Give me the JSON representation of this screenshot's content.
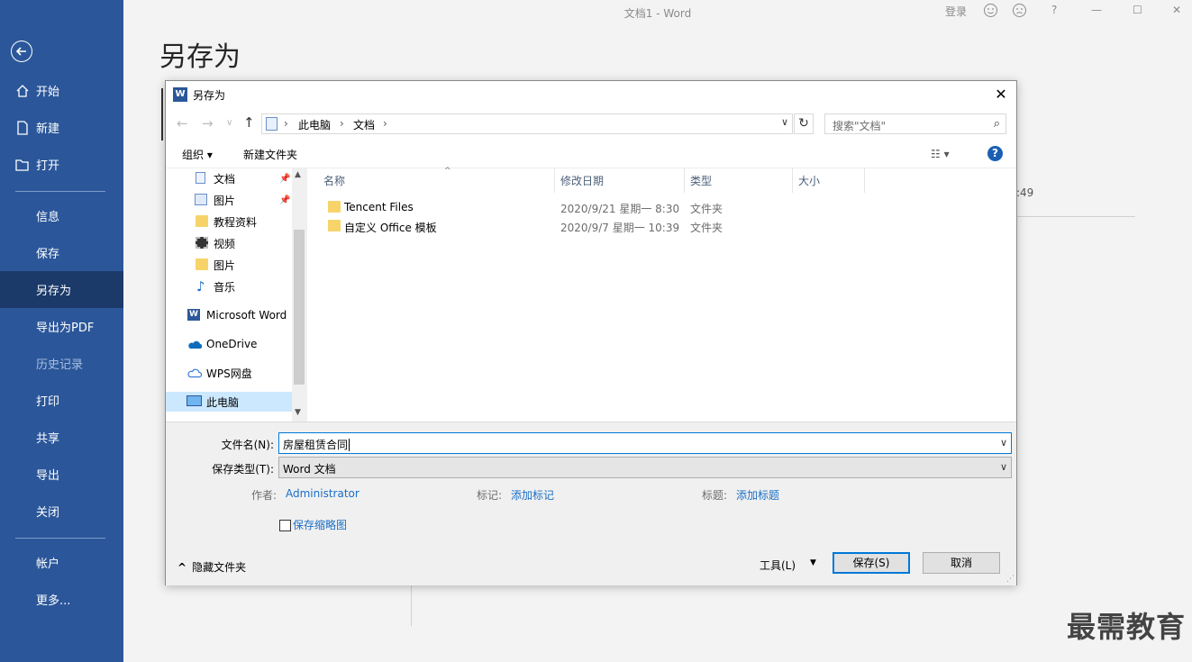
{
  "window": {
    "doc_title": "文档1  -  Word",
    "login": "登录",
    "help": "?",
    "minimize": "—",
    "maximize": "☐",
    "close": "✕"
  },
  "sidebar": {
    "items": [
      {
        "label": "开始",
        "icon": "home-icon"
      },
      {
        "label": "新建",
        "icon": "new-doc-icon"
      },
      {
        "label": "打开",
        "icon": "open-folder-icon"
      },
      {
        "label": "信息"
      },
      {
        "label": "保存"
      },
      {
        "label": "另存为"
      },
      {
        "label": "导出为PDF"
      },
      {
        "label": "历史记录"
      },
      {
        "label": "打印"
      },
      {
        "label": "共享"
      },
      {
        "label": "导出"
      },
      {
        "label": "关闭"
      },
      {
        "label": "帐户"
      },
      {
        "label": "更多..."
      }
    ],
    "active": "另存为"
  },
  "main": {
    "page_title": "另存为",
    "bg_time_fragment": ":49"
  },
  "watermark": "最需教育",
  "dialog": {
    "title": "另存为",
    "title_icon": "W",
    "close": "✕",
    "nav": {
      "back": "←",
      "forward": "→",
      "recent": "∨",
      "up": "↑"
    },
    "address": {
      "crumbs": [
        "此电脑",
        "文档"
      ],
      "sep": "›",
      "dropdown": "∨",
      "refresh": "↻"
    },
    "search_placeholder": "搜索\"文档\"",
    "search_icon": "⌕",
    "toolbar": {
      "organize": "组织 ▾",
      "new_folder": "新建文件夹",
      "view": "☷ ▾",
      "help": "?"
    },
    "nav_pane": [
      {
        "label": "文档",
        "icon": "documents-icon",
        "pinned": true
      },
      {
        "label": "图片",
        "icon": "pictures-icon",
        "pinned": true
      },
      {
        "label": "教程资料",
        "icon": "folder-icon"
      },
      {
        "label": "视频",
        "icon": "videos-icon"
      },
      {
        "label": "图片",
        "icon": "folder-icon"
      },
      {
        "label": "音乐",
        "icon": "music-icon"
      },
      {
        "label": "Microsoft Word",
        "icon": "word-icon"
      },
      {
        "label": "OneDrive",
        "icon": "onedrive-icon"
      },
      {
        "label": "WPS网盘",
        "icon": "wps-cloud-icon"
      },
      {
        "label": "此电脑",
        "icon": "this-pc-icon"
      }
    ],
    "pin_glyph": "📌",
    "columns": [
      "名称",
      "修改日期",
      "类型",
      "大小"
    ],
    "sort_arrow": "^",
    "files": [
      {
        "name": "Tencent Files",
        "date": "2020/9/21 星期一 8:30",
        "type": "文件夹",
        "size": ""
      },
      {
        "name": "自定义 Office 模板",
        "date": "2020/9/7 星期一 10:39",
        "type": "文件夹",
        "size": ""
      }
    ],
    "form": {
      "filename_label": "文件名(N):",
      "filename_value": "房屋租赁合同",
      "filetype_label": "保存类型(T):",
      "filetype_value": "Word 文档",
      "author_label": "作者:",
      "author_value": "Administrator",
      "tags_label": "标记:",
      "tags_value": "添加标记",
      "title_label": "标题:",
      "title_value": "添加标题",
      "thumbnail_label": "保存缩略图",
      "hide_folders": "隐藏文件夹",
      "hide_caret": "^",
      "tools": "工具(L)",
      "tools_caret": "▼",
      "save": "保存(S)",
      "cancel": "取消"
    }
  }
}
